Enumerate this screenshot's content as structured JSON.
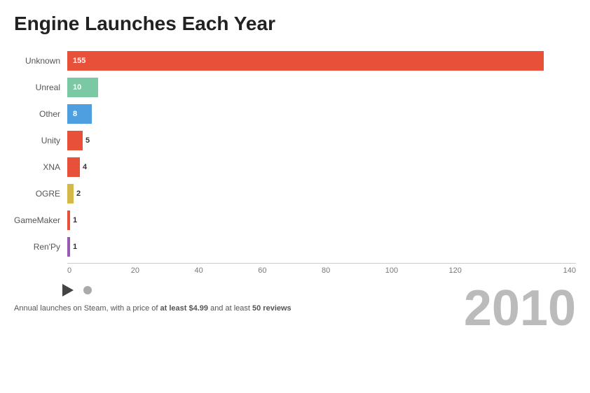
{
  "title": "Engine Launches Each Year",
  "year": "2010",
  "footnote_pre": "Annual launches on Steam, with a price of ",
  "footnote_bold1": "at least $4.99",
  "footnote_mid": " and at least ",
  "footnote_bold2": "50 reviews",
  "bars": [
    {
      "label": "Unknown",
      "value": 155,
      "color": "#e8503a",
      "maxWidth": 700
    },
    {
      "label": "Unreal",
      "value": 10,
      "color": "#7bc8a4",
      "maxWidth": 700
    },
    {
      "label": "Other",
      "value": 8,
      "color": "#4e9fdf",
      "maxWidth": 700
    },
    {
      "label": "Unity",
      "value": 5,
      "color": "#e8503a",
      "maxWidth": 700
    },
    {
      "label": "XNA",
      "value": 4,
      "color": "#e8503a",
      "maxWidth": 700
    },
    {
      "label": "OGRE",
      "value": 2,
      "color": "#d4b84a",
      "maxWidth": 700
    },
    {
      "label": "GameMaker",
      "value": 1,
      "color": "#e8503a",
      "maxWidth": 700
    },
    {
      "label": "Ren'Py",
      "value": 1,
      "color": "#9b59b6",
      "maxWidth": 700
    }
  ],
  "x_axis": {
    "ticks": [
      "0",
      "20",
      "40",
      "60",
      "80",
      "100",
      "120",
      "140"
    ]
  },
  "controls": {
    "play_label": "▶",
    "dot_label": "●"
  }
}
